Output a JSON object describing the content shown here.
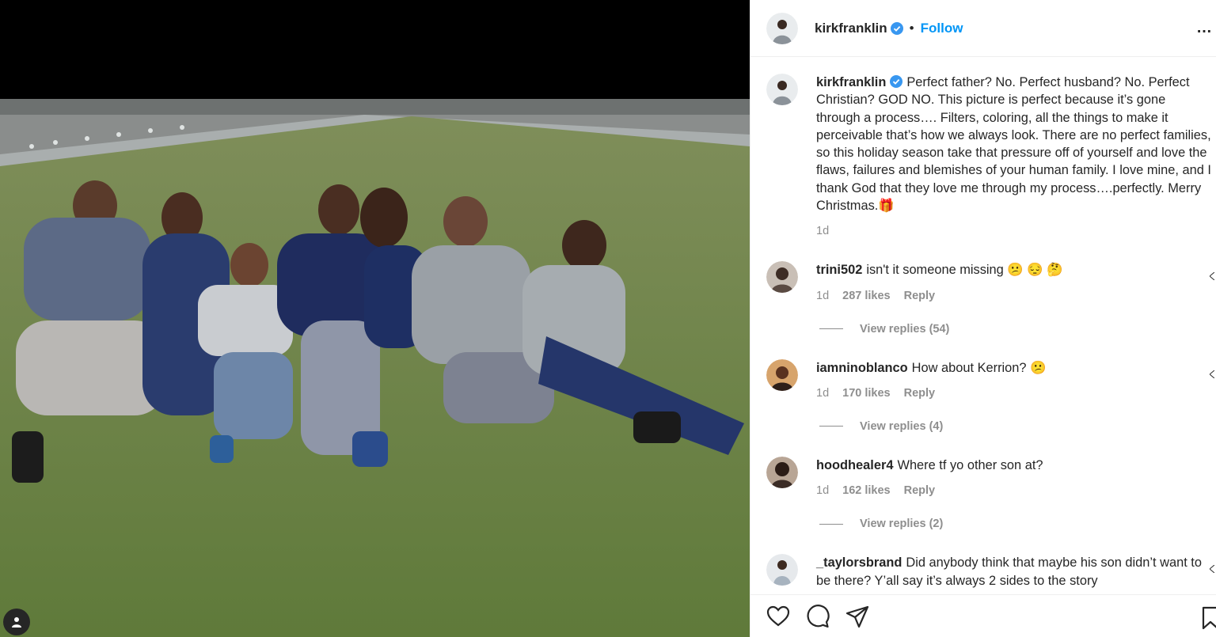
{
  "post": {
    "username": "kirkfranklin",
    "separator": "•",
    "follow_label": "Follow",
    "more_label": "…",
    "caption": "Perfect father? No. Perfect husband? No. Perfect Christian? GOD NO. This picture is perfect because it’s gone through a process…. Filters, coloring, all the things to make it perceivable that’s how we always look. There are no perfect families, so this holiday season take that pressure off of yourself and love the flaws, failures and blemishes of your human family. I love mine, and I thank God that they love me through my process….perfectly. Merry Christmas.🎁",
    "caption_age": "1d"
  },
  "comments": [
    {
      "username": "trini502",
      "text": "isn't it someone missing 😕 😔 🤔",
      "age": "1d",
      "likes": "287 likes",
      "reply": "Reply",
      "view_replies": "View replies (54)"
    },
    {
      "username": "iamninoblanco",
      "text": "How about Kerrion? 😕",
      "age": "1d",
      "likes": "170 likes",
      "reply": "Reply",
      "view_replies": "View replies (4)"
    },
    {
      "username": "hoodhealer4",
      "text": "Where tf yo other son at?",
      "age": "1d",
      "likes": "162 likes",
      "reply": "Reply",
      "view_replies": "View replies (2)"
    },
    {
      "username": "_taylorsbrand",
      "text": "Did anybody think that maybe his son didn’t want to be there? Y’all say it’s always 2 sides to the story"
    }
  ],
  "icons": {
    "like": "heart-icon",
    "comment": "comment-icon",
    "share": "share-icon",
    "save": "bookmark-icon",
    "verified": "verified-badge-icon",
    "tag": "user-tag-icon"
  },
  "colors": {
    "link": "#0095f6",
    "muted": "#8e8e8e",
    "text": "#262626",
    "verified": "#3897f0"
  }
}
